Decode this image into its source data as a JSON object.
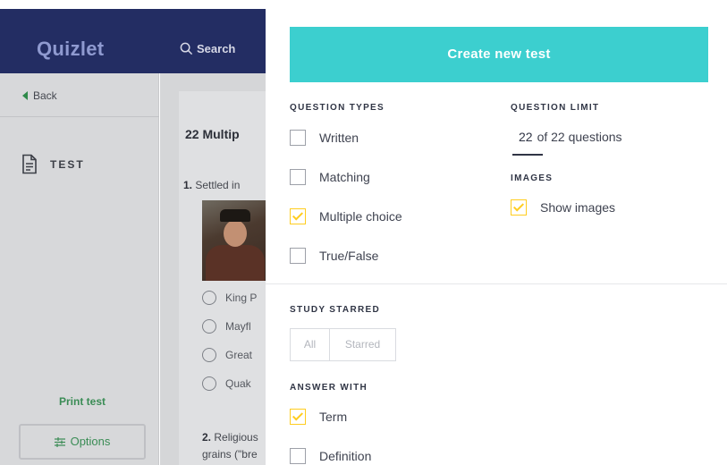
{
  "app": {
    "logo": "Quizlet",
    "search_label": "Search"
  },
  "sidebar": {
    "back_label": "Back",
    "mode_label": "TEST",
    "print_label": "Print test",
    "options_label": "Options"
  },
  "test": {
    "title": "22 Multip",
    "q1_number": "1.",
    "q1_text": "Settled in",
    "choices": [
      "King P",
      "Mayfl",
      "Great",
      "Quak"
    ],
    "q2_number": "2.",
    "q2_line1": "Religious",
    "q2_line2": "grains (\"bre"
  },
  "panel": {
    "create_label": "Create new test",
    "question_types_label": "QUESTION TYPES",
    "question_types": [
      {
        "label": "Written",
        "checked": false
      },
      {
        "label": "Matching",
        "checked": false
      },
      {
        "label": "Multiple choice",
        "checked": true
      },
      {
        "label": "True/False",
        "checked": false
      }
    ],
    "question_limit_label": "QUESTION LIMIT",
    "question_limit_value": "22",
    "question_limit_suffix": "of 22 questions",
    "images_label": "IMAGES",
    "show_images_label": "Show images",
    "show_images_checked": true,
    "study_starred_label": "STUDY STARRED",
    "starred_options": [
      "All",
      "Starred"
    ],
    "answer_with_label": "ANSWER WITH",
    "answer_with": [
      {
        "label": "Term",
        "checked": true
      },
      {
        "label": "Definition",
        "checked": false
      }
    ]
  },
  "colors": {
    "accent": "#3ccfcf",
    "check": "#ffcd1f",
    "nav": "#232d63",
    "link_green": "#3a8c55"
  }
}
